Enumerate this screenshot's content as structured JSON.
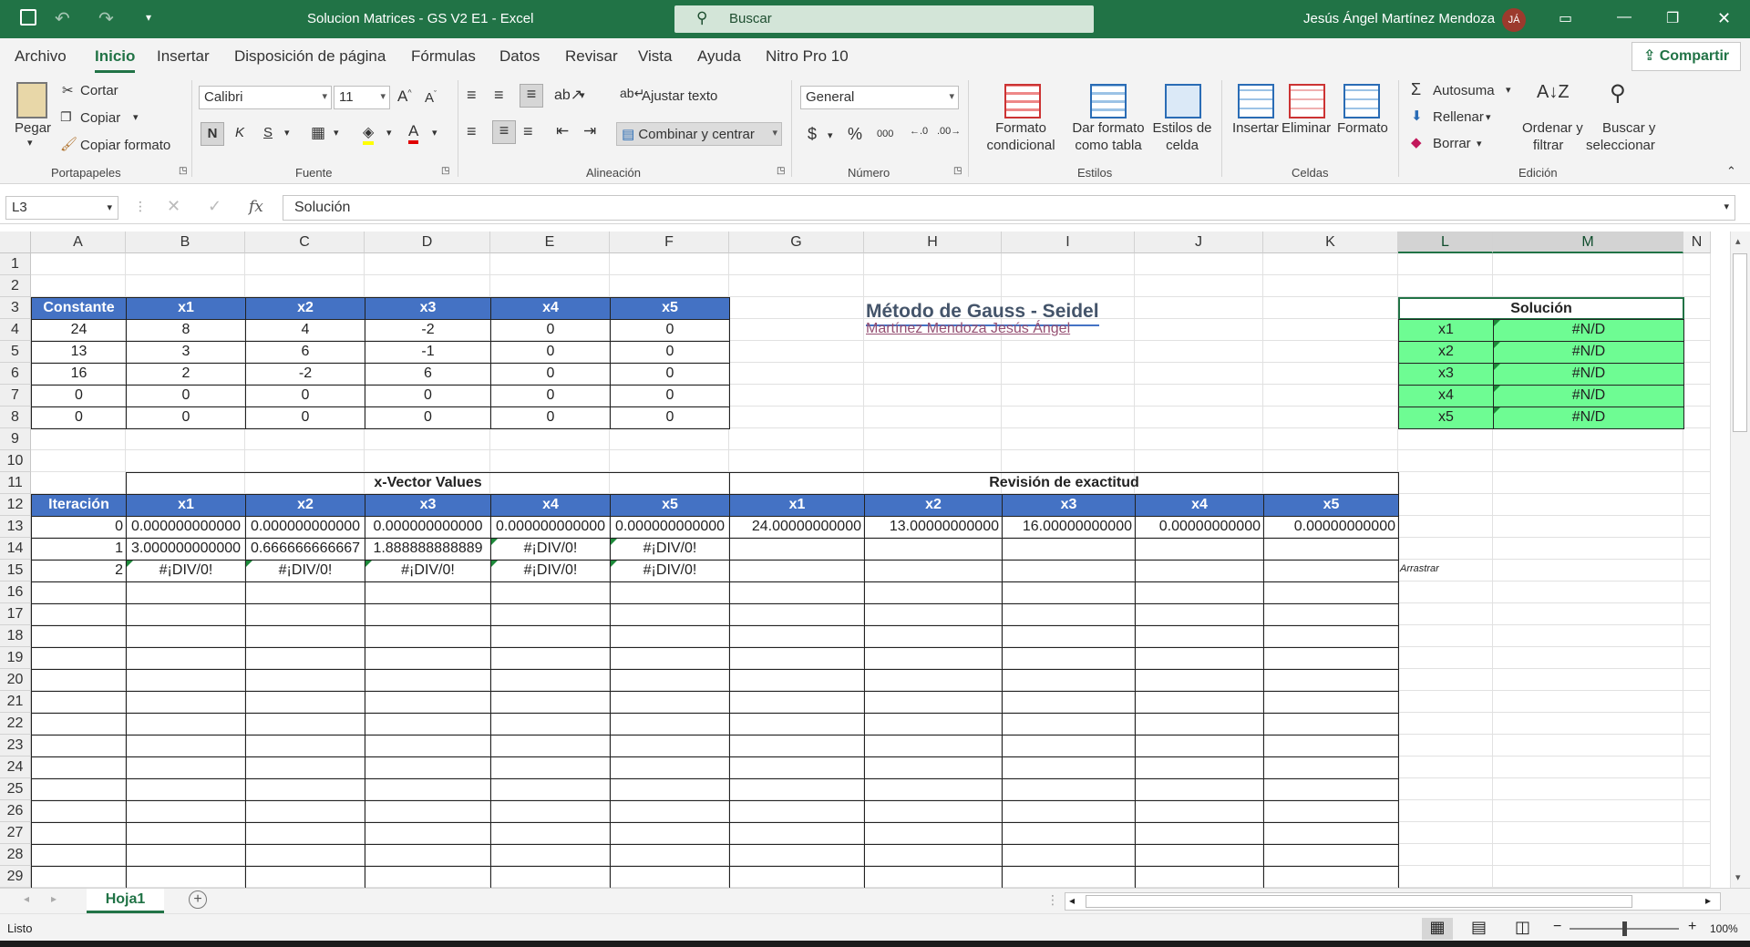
{
  "window": {
    "title": "Solucion Matrices - GS V2 E1  -  Excel",
    "search_placeholder": "Buscar",
    "user_name": "Jesús Ángel Martínez Mendoza",
    "user_initials": "JÁ"
  },
  "menu": {
    "items": [
      "Archivo",
      "Inicio",
      "Insertar",
      "Disposición de página",
      "Fórmulas",
      "Datos",
      "Revisar",
      "Vista",
      "Ayuda",
      "Nitro Pro 10"
    ],
    "active": "Inicio",
    "share": "Compartir"
  },
  "ribbon": {
    "clipboard": {
      "paste": "Pegar",
      "cut": "Cortar",
      "copy": "Copiar",
      "format_painter": "Copiar formato",
      "group": "Portapapeles"
    },
    "font": {
      "name": "Calibri",
      "size": "11",
      "bold": "N",
      "italic": "K",
      "underline": "S",
      "group": "Fuente"
    },
    "alignment": {
      "wrap": "Ajustar texto",
      "merge": "Combinar y centrar",
      "group": "Alineación"
    },
    "number": {
      "format": "General",
      "currency": "$",
      "percent": "%",
      "thousands": "000",
      "group": "Número"
    },
    "styles": {
      "conditional": "Formato",
      "conditional2": "condicional",
      "table": "Dar formato",
      "table2": "como tabla",
      "cell": "Estilos de",
      "cell2": "celda",
      "group": "Estilos"
    },
    "cells": {
      "insert": "Insertar",
      "delete": "Eliminar",
      "format": "Formato",
      "group": "Celdas"
    },
    "editing": {
      "autosum": "Autosuma",
      "fill": "Rellenar",
      "clear": "Borrar",
      "sort": "Ordenar y",
      "sort2": "filtrar",
      "find": "Buscar y",
      "find2": "seleccionar",
      "group": "Edición"
    }
  },
  "formula_bar": {
    "name_box": "L3",
    "fx": "fx",
    "content": "Solución"
  },
  "columns": [
    "A",
    "B",
    "C",
    "D",
    "E",
    "F",
    "G",
    "H",
    "I",
    "J",
    "K",
    "L",
    "M",
    "N"
  ],
  "rows": [
    "1",
    "2",
    "3",
    "4",
    "5",
    "6",
    "7",
    "8",
    "9",
    "10",
    "11",
    "12",
    "13",
    "14",
    "15",
    "16",
    "17",
    "18",
    "19",
    "20",
    "21",
    "22",
    "23",
    "24",
    "25",
    "26",
    "27",
    "28",
    "29"
  ],
  "matrix": {
    "headers": [
      "Constante",
      "x1",
      "x2",
      "x3",
      "x4",
      "x5"
    ],
    "rows": [
      [
        "24",
        "8",
        "4",
        "-2",
        "0",
        "0"
      ],
      [
        "13",
        "3",
        "6",
        "-1",
        "0",
        "0"
      ],
      [
        "16",
        "2",
        "-2",
        "6",
        "0",
        "0"
      ],
      [
        "0",
        "0",
        "0",
        "0",
        "0",
        "0"
      ],
      [
        "0",
        "0",
        "0",
        "0",
        "0",
        "0"
      ]
    ]
  },
  "info": {
    "title": "Método de Gauss - Seidel",
    "author": "Martínez Mendoza Jesús Ángel"
  },
  "solution": {
    "title": "Solución",
    "labels": [
      "x1",
      "x2",
      "x3",
      "x4",
      "x5"
    ],
    "values": [
      "#N/D",
      "#N/D",
      "#N/D",
      "#N/D",
      "#N/D"
    ]
  },
  "iterations": {
    "group_x": "x-Vector Values",
    "group_check": "Revisión de exactitud",
    "iter_header": "Iteración",
    "x_headers": [
      "x1",
      "x2",
      "x3",
      "x4",
      "x5"
    ],
    "check_headers": [
      "x1",
      "x2",
      "x3",
      "x4",
      "x5"
    ],
    "rows": [
      {
        "i": "0",
        "x": [
          "0.000000000000",
          "0.000000000000",
          "0.000000000000",
          "0.000000000000",
          "0.000000000000"
        ],
        "check": [
          "24.00000000000",
          "13.00000000000",
          "16.00000000000",
          "0.00000000000",
          "0.00000000000"
        ]
      },
      {
        "i": "1",
        "x": [
          "3.000000000000",
          "0.666666666667",
          "1.888888888889",
          "#¡DIV/0!",
          "#¡DIV/0!"
        ],
        "check": [
          "",
          "",
          "",
          "",
          ""
        ]
      },
      {
        "i": "2",
        "x": [
          "#¡DIV/0!",
          "#¡DIV/0!",
          "#¡DIV/0!",
          "#¡DIV/0!",
          "#¡DIV/0!"
        ],
        "check": [
          "",
          "",
          "",
          "",
          ""
        ]
      }
    ]
  },
  "note": "Arrastrar",
  "sheet_tab": "Hoja1",
  "status": {
    "ready": "Listo",
    "zoom": "100%"
  },
  "colors": {
    "accent": "#217346",
    "header_blue": "#4472c4",
    "solution_green": "#6efc93"
  }
}
